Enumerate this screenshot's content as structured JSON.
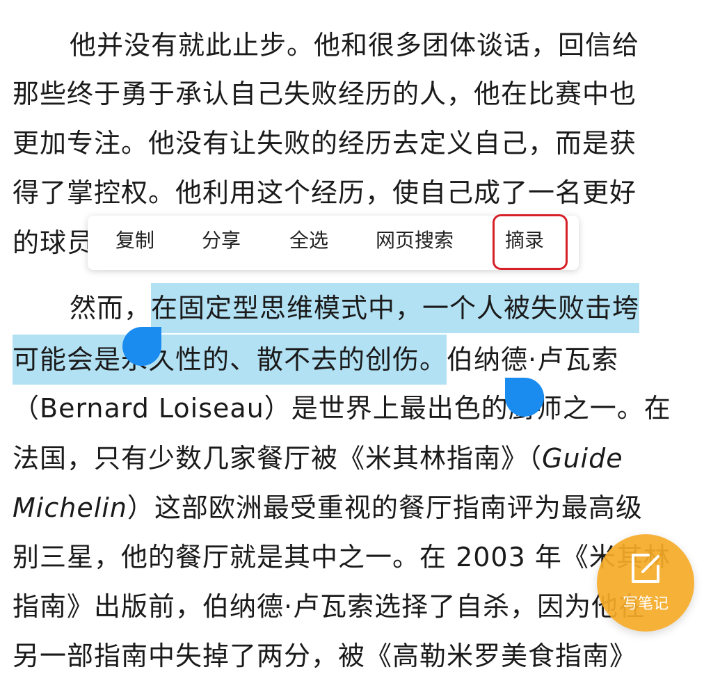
{
  "reader": {
    "lines": [
      "他并没有就此止步。他和很多团体谈话，回信给",
      "那些终于勇于承认自己失败经历的人，他在比赛中也",
      "更加专注。他没有让失败的经历去定义自己，而是获",
      "得了掌控权。他利用这个经历，使自己成了一名更好",
      "的球员"
    ],
    "p2_line1_pre": "然而，",
    "p2_line1_sel": "在固定型思维模式中，一个人被失败击垮",
    "p2_line2_sel": "可能会是永久性的、散不去的创伤。",
    "p2_line2_post": "伯纳德·卢瓦索",
    "p2_line3": "（Bernard Loiseau）是世界上最出色的厨师之一。在",
    "p2_line4_pre": "法国，只有少数几家餐厅被《米其林指南》（",
    "p2_line4_italic": "Guide",
    "p2_line5_italic": "Michelin",
    "p2_line5_post": "）这部欧洲最受重视的餐厅指南评为最高级",
    "p2_line6": "别三星，他的餐厅就是其中之一。在 2003 年《米其林",
    "p2_line7": "指南》出版前，伯纳德·卢瓦索选择了自杀，因为他在",
    "p2_line8": "另一部指南中失掉了两分，被《高勒米罗美食指南》"
  },
  "context_menu": {
    "copy": "复制",
    "share": "分享",
    "select_all": "全选",
    "web_search": "网页搜索",
    "excerpt": "摘录"
  },
  "fab": {
    "label": "写笔记",
    "color": "#F5AA28"
  },
  "colors": {
    "selection": "#B3E1F4",
    "handle": "#1A8CF0",
    "highlight_box": "#D62027"
  }
}
